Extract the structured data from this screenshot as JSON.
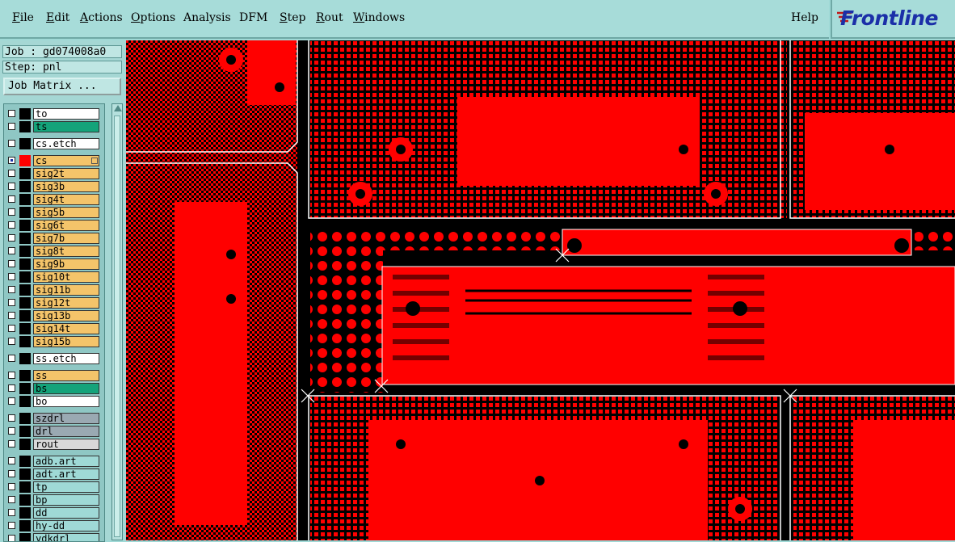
{
  "menu": [
    {
      "label": "File",
      "ul": "F",
      "rest": "ile"
    },
    {
      "label": "Edit",
      "ul": "E",
      "rest": "dit"
    },
    {
      "label": "Actions",
      "ul": "A",
      "rest": "ctions"
    },
    {
      "label": "Options",
      "ul": "O",
      "rest": "ptions"
    },
    {
      "label": "Analysis",
      "ul": "",
      "rest": "Analysis"
    },
    {
      "label": "DFM",
      "ul": "",
      "rest": "DFM"
    },
    {
      "label": "Step",
      "ul": "S",
      "rest": "tep"
    },
    {
      "label": "Rout",
      "ul": "R",
      "rest": "out"
    },
    {
      "label": "Windows",
      "ul": "W",
      "rest": "indows"
    }
  ],
  "help_label": "Help",
  "logo": {
    "text": "Frontline"
  },
  "job_line": "Job : gd074008a0",
  "step_line": "Step: pnl",
  "job_matrix_label": "Job Matrix ...",
  "layers": [
    {
      "name": "to",
      "color": "#ffffff",
      "group": 0
    },
    {
      "name": "ts",
      "color": "#14a37a",
      "group": 0
    },
    {
      "name": "cs.etch",
      "color": "#ffffff",
      "group": 1
    },
    {
      "name": "cs",
      "color": "#f4c46a",
      "group": 2,
      "active": true,
      "swatch": "#ff0000"
    },
    {
      "name": "sig2t",
      "color": "#f4c46a",
      "group": 2
    },
    {
      "name": "sig3b",
      "color": "#f4c46a",
      "group": 2
    },
    {
      "name": "sig4t",
      "color": "#f4c46a",
      "group": 2
    },
    {
      "name": "sig5b",
      "color": "#f4c46a",
      "group": 2
    },
    {
      "name": "sig6t",
      "color": "#f4c46a",
      "group": 2
    },
    {
      "name": "sig7b",
      "color": "#f4c46a",
      "group": 2
    },
    {
      "name": "sig8t",
      "color": "#f4c46a",
      "group": 2
    },
    {
      "name": "sig9b",
      "color": "#f4c46a",
      "group": 2
    },
    {
      "name": "sig10t",
      "color": "#f4c46a",
      "group": 2
    },
    {
      "name": "sig11b",
      "color": "#f4c46a",
      "group": 2
    },
    {
      "name": "sig12t",
      "color": "#f4c46a",
      "group": 2
    },
    {
      "name": "sig13b",
      "color": "#f4c46a",
      "group": 2
    },
    {
      "name": "sig14t",
      "color": "#f4c46a",
      "group": 2
    },
    {
      "name": "sig15b",
      "color": "#f4c46a",
      "group": 2
    },
    {
      "name": "ss.etch",
      "color": "#ffffff",
      "group": 3
    },
    {
      "name": "ss",
      "color": "#f4c46a",
      "group": 4
    },
    {
      "name": "bs",
      "color": "#14a37a",
      "group": 4
    },
    {
      "name": "bo",
      "color": "#ffffff",
      "group": 4
    },
    {
      "name": "szdrl",
      "color": "#9aa9b2",
      "group": 5
    },
    {
      "name": "drl",
      "color": "#9aa9b2",
      "group": 5
    },
    {
      "name": "rout",
      "color": "#d8d8d8",
      "group": 5
    },
    {
      "name": "adb.art",
      "color": "#9fd9d6",
      "group": 6
    },
    {
      "name": "adt.art",
      "color": "#9fd9d6",
      "group": 6
    },
    {
      "name": "tp",
      "color": "#9fd9d6",
      "group": 6
    },
    {
      "name": "bp",
      "color": "#9fd9d6",
      "group": 6
    },
    {
      "name": "dd",
      "color": "#9fd9d6",
      "group": 6
    },
    {
      "name": "hy-dd",
      "color": "#9fd9d6",
      "group": 6
    },
    {
      "name": "ydkdrl",
      "color": "#9fd9d6",
      "group": 6
    }
  ],
  "colors": {
    "copper": "#ff0000",
    "board": "#000000",
    "outline": "#ffffff",
    "ui_bg": "#a7dcd9"
  }
}
